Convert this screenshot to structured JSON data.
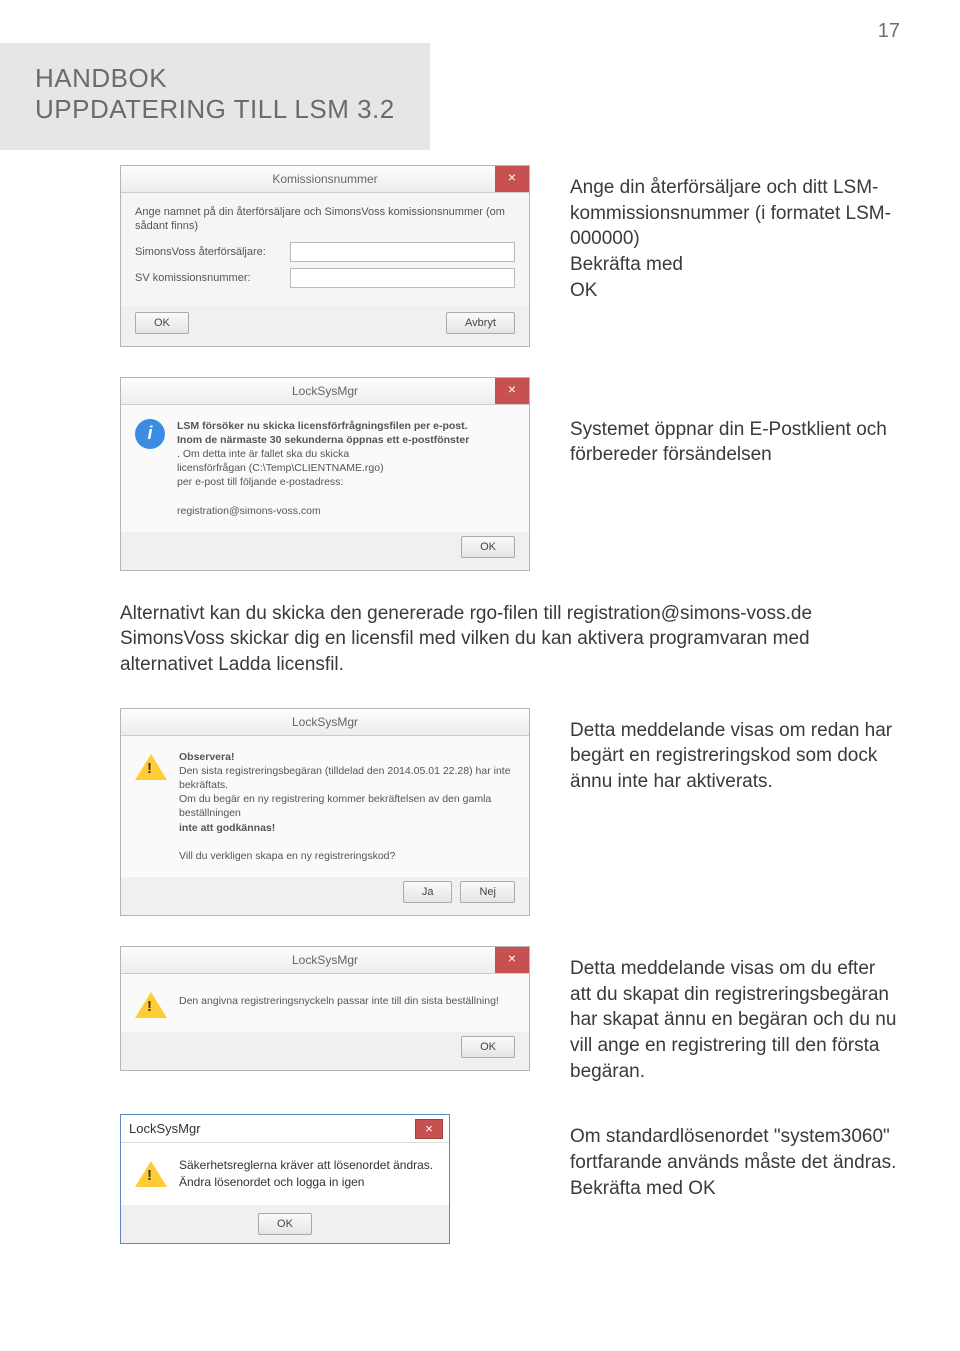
{
  "page_number": "17",
  "title_line1": "HANDBOK",
  "title_line2": "UPPDATERING TILL LSM 3.2",
  "section1": {
    "dlg1": {
      "title": "Komissionsnummer",
      "body_text": "Ange namnet på din återförsäljare och SimonsVoss komissionsnummer (om sådant finns)",
      "field1_label": "SimonsVoss återförsäljare:",
      "field2_label": "SV komissionsnummer:",
      "btn_ok": "OK",
      "btn_cancel": "Avbryt"
    },
    "side_text": "Ange din återförsäljare och ditt LSM-kommissionsnummer (i formatet LSM-000000)",
    "side_text2": "Bekräfta med",
    "side_text3": "OK"
  },
  "section2": {
    "dlg2": {
      "title": "LockSysMgr",
      "body_line1": "LSM försöker nu skicka licensförfrågningsfilen per e-post.",
      "body_line2": "Inom de närmaste 30 sekunderna öppnas ett e-postfönster",
      "body_line3": ". Om detta inte är fallet ska du skicka",
      "body_line4": "licensförfrågan (C:\\Temp\\CLIENTNAME.rgo)",
      "body_line5": "per e-post till följande e-postadress:",
      "body_line6": "registration@simons-voss.com",
      "btn_ok": "OK"
    },
    "side_text": "Systemet öppnar din E-Postklient och förbereder försändelsen"
  },
  "mid_text": "Alternativt kan du skicka den genererade rgo-filen till registration@simons-voss.de",
  "mid_text2": "SimonsVoss skickar dig en licensfil med vilken du kan aktivera programvaran med alternativet Ladda licensfil.",
  "section3": {
    "dlg3": {
      "title": "LockSysMgr",
      "body_line1": "Observera!",
      "body_line2": "Den sista registreringsbegäran (tilldelad den 2014.05.01 22.28) har inte bekräftats.",
      "body_line3": "Om du begär en ny registrering kommer bekräftelsen av den gamla beställningen",
      "body_line4": "inte att godkännas!",
      "body_line5": "Vill du verkligen skapa en ny registreringskod?",
      "btn_yes": "Ja",
      "btn_no": "Nej"
    },
    "side_text": "Detta meddelande visas om redan har begärt en registreringskod som dock ännu inte har aktiverats."
  },
  "section4": {
    "dlg4": {
      "title": "LockSysMgr",
      "body": "Den angivna registreringsnyckeln passar inte till din sista beställning!",
      "btn_ok": "OK"
    },
    "side_text": "Detta meddelande visas om du efter att du skapat din registreringsbegäran har skapat ännu en begäran och du nu vill ange en registrering till den första begäran."
  },
  "section5": {
    "dlg5": {
      "title": "LockSysMgr",
      "body_line1": "Säkerhetsreglerna kräver att lösenordet ändras.",
      "body_line2": "Ändra lösenordet och logga in igen",
      "btn_ok": "OK"
    },
    "side_text1": "Om standardlösenordet \"system3060\" fortfarande används måste det ändras.",
    "side_text2": "Bekräfta med OK"
  }
}
